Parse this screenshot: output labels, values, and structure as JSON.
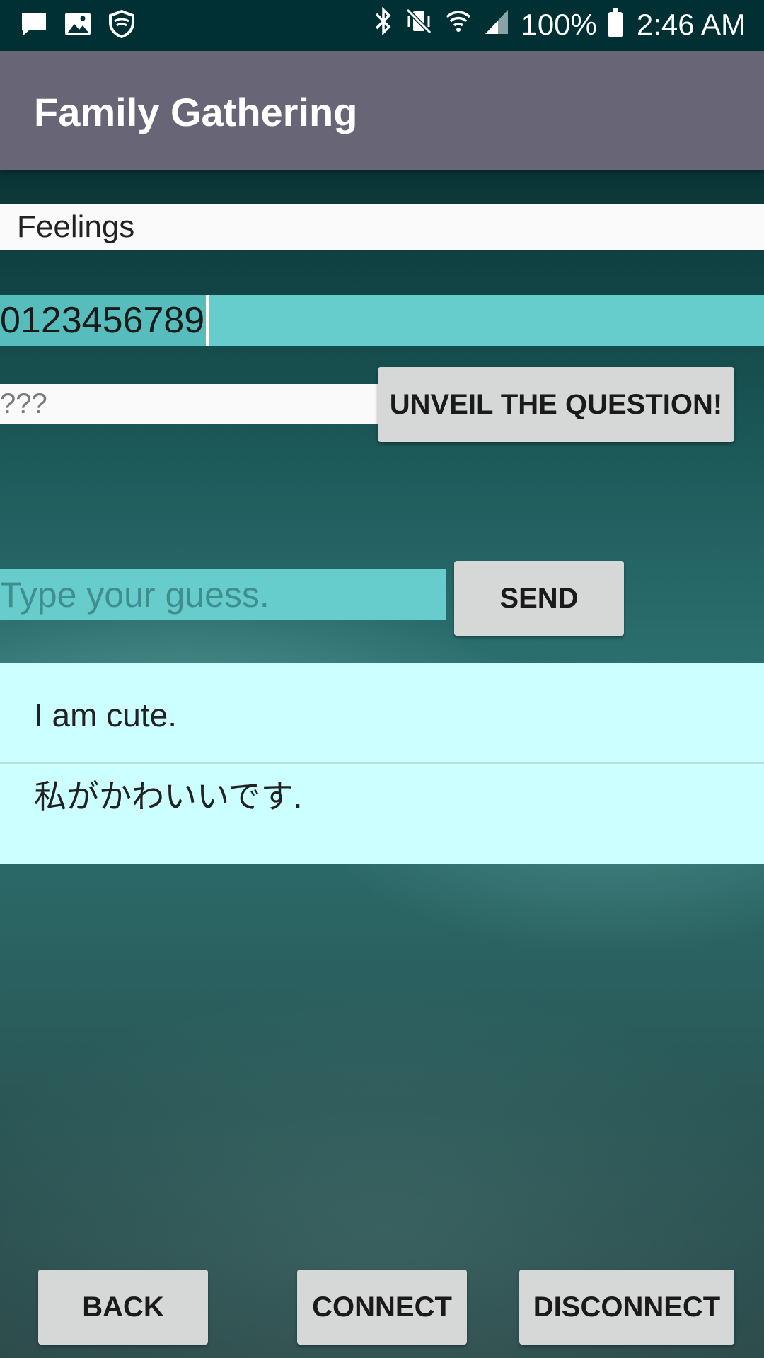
{
  "status_bar": {
    "battery": "100%",
    "time": "2:46 AM",
    "left_icons": [
      "message-icon",
      "image-icon",
      "shield-icon"
    ],
    "right_icons": [
      "bluetooth-icon",
      "vibrate-mute-icon",
      "wifi-icon",
      "signal-icon",
      "battery-icon"
    ]
  },
  "app_bar": {
    "title": "Family Gathering"
  },
  "category": {
    "label": "Feelings"
  },
  "code_field": {
    "value": "0123456789"
  },
  "question_field": {
    "value": "???"
  },
  "unveil_button": {
    "label": "UNVEIL THE QUESTION!"
  },
  "guess_field": {
    "placeholder": "Type your guess."
  },
  "send_button": {
    "label": "SEND"
  },
  "answers": [
    {
      "text": "I am cute."
    },
    {
      "text": "私がかわいいです."
    }
  ],
  "bottom_buttons": {
    "back": "BACK",
    "connect": "CONNECT",
    "disconnect": "DISCONNECT"
  },
  "colors": {
    "status_bar": "#003033",
    "app_bar": "#686676",
    "accent_field": "#66cccc",
    "list_background": "#ccffff",
    "button": "#d6d7d7"
  }
}
